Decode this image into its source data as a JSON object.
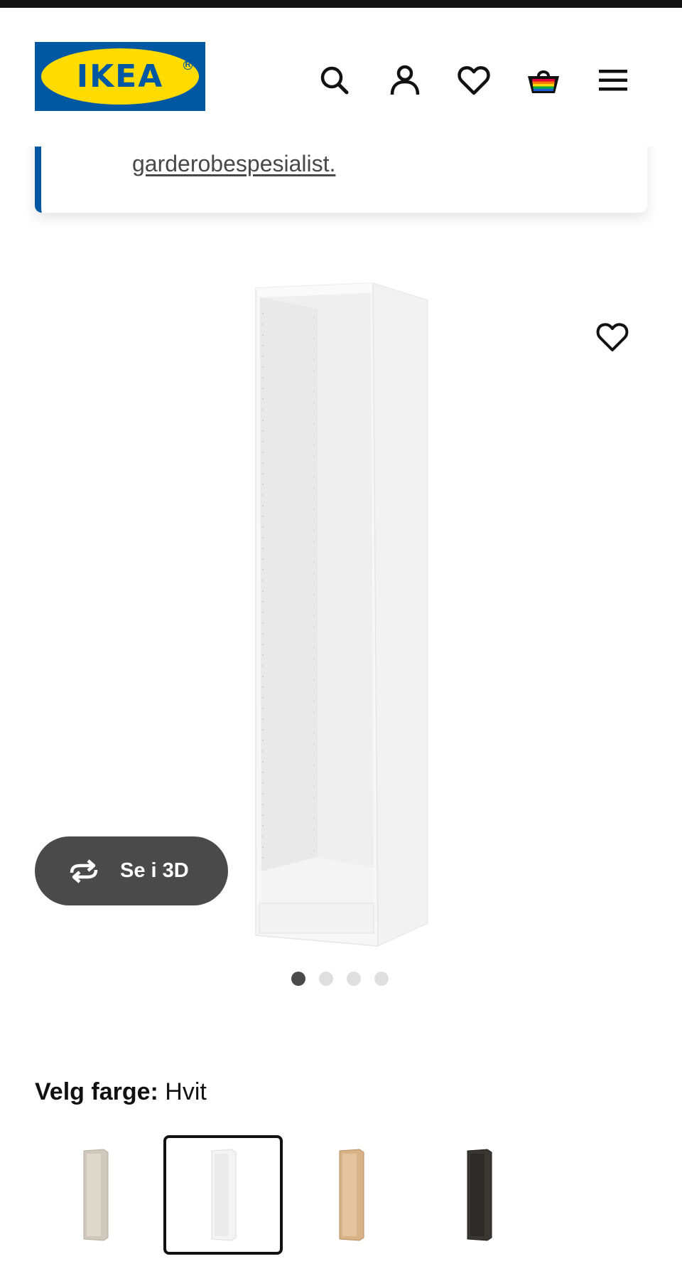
{
  "header": {
    "logo_text": "IKEA",
    "logo_reg": "R",
    "icons": [
      "search-icon",
      "account-icon",
      "favourites-icon",
      "cart-icon",
      "menu-icon"
    ]
  },
  "notice": {
    "link_text": "garderobespesialist."
  },
  "gallery": {
    "view_3d_label": "Se i 3D",
    "image_count": 4,
    "active_image": 1
  },
  "color_picker": {
    "label": "Velg farge:",
    "selected_value": "Hvit",
    "swatches": [
      {
        "name": "beige",
        "color": "#cfc8bc"
      },
      {
        "name": "white",
        "color": "#f2f2f2"
      },
      {
        "name": "oak",
        "color": "#d8b288"
      },
      {
        "name": "black-brown",
        "color": "#3a3632"
      }
    ],
    "selected_index": 1
  },
  "colors": {
    "brand_blue": "#0058a3",
    "brand_yellow": "#ffdb00",
    "dark_button": "#4a4a4a"
  }
}
